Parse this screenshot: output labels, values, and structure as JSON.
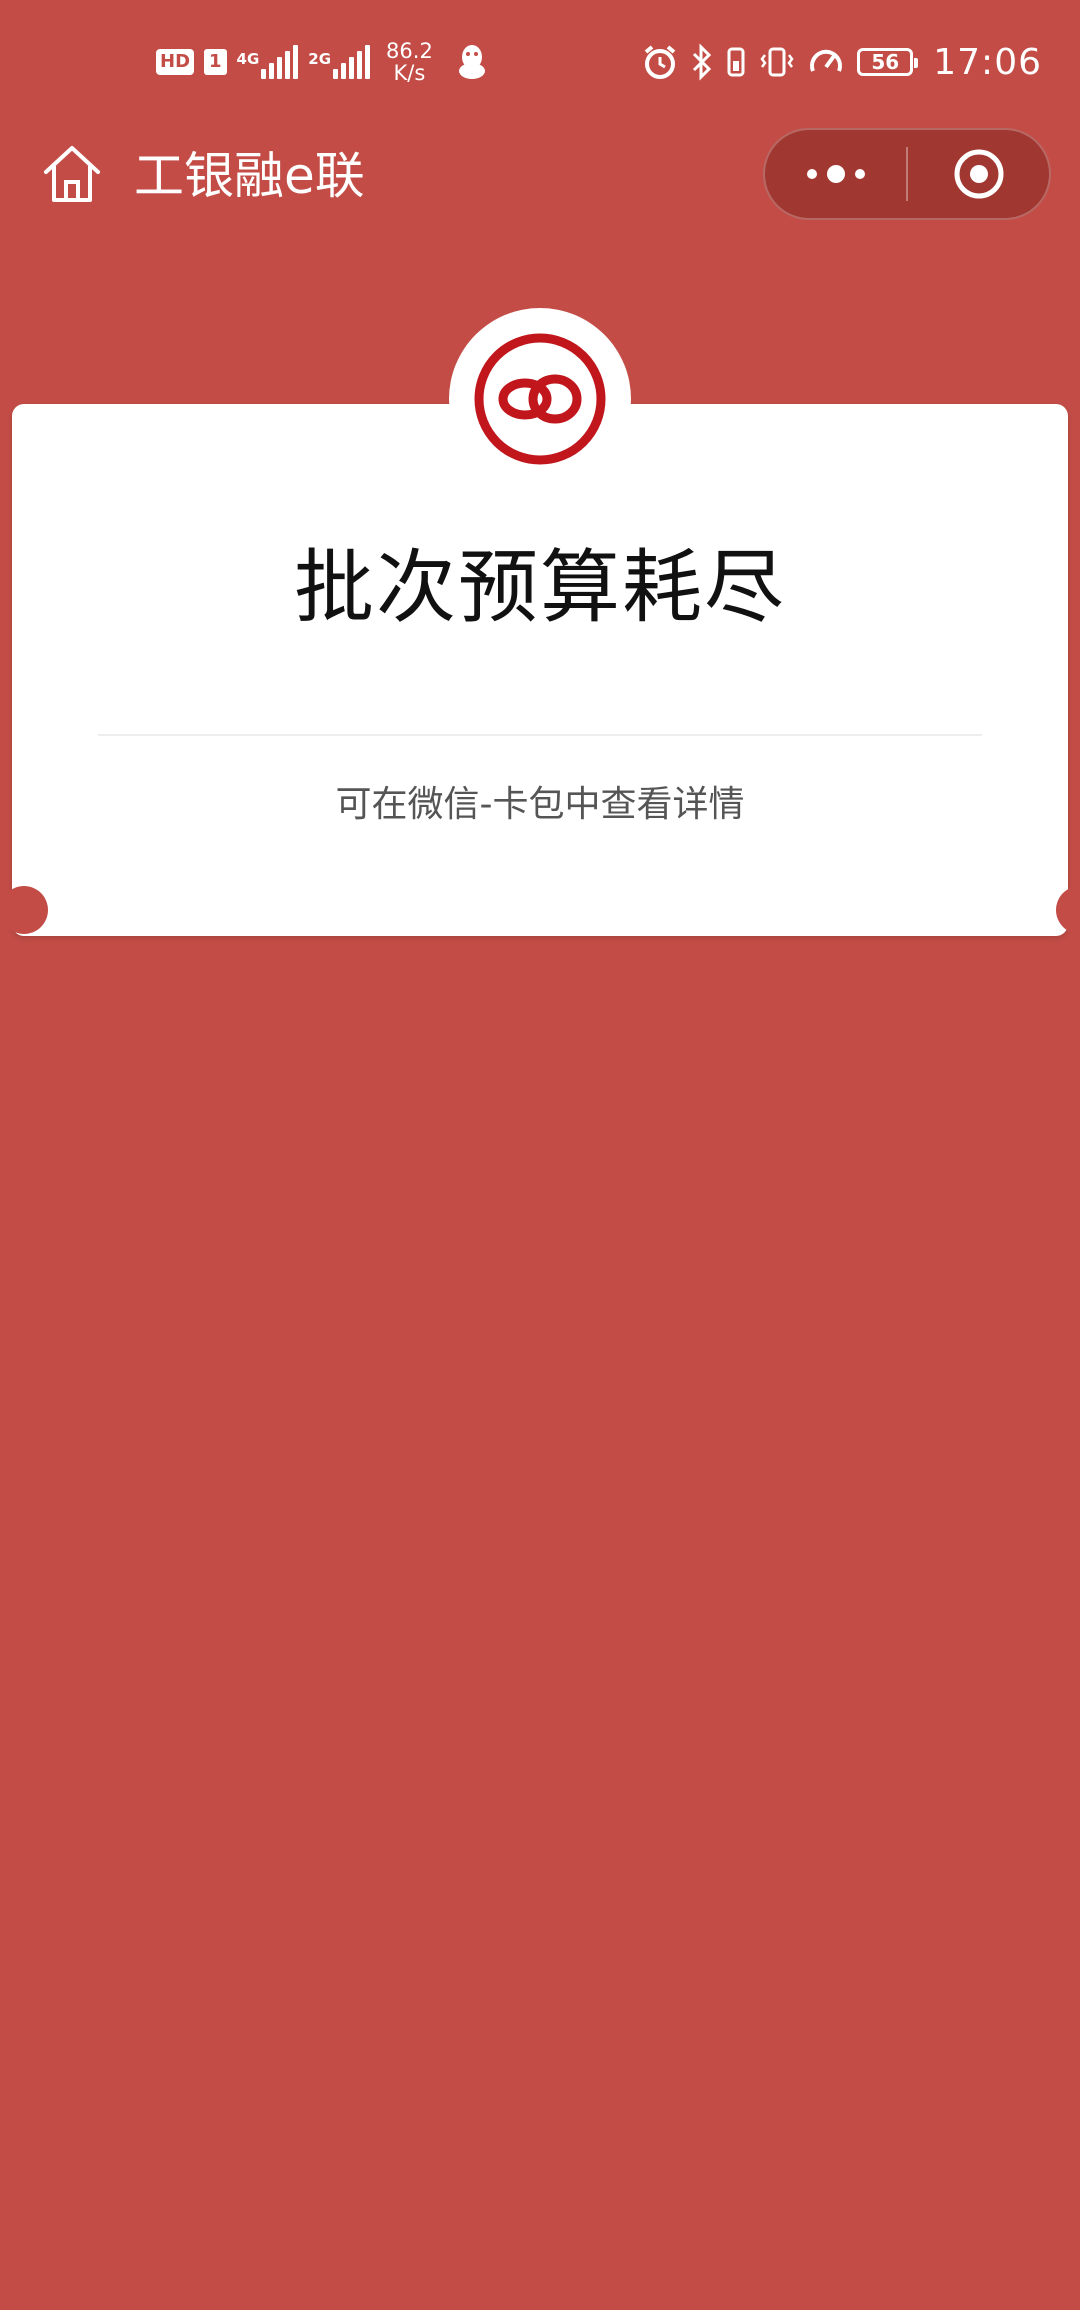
{
  "status_bar": {
    "hd_label": "HD",
    "sim_label": "1",
    "network_1": "4G",
    "network_2": "2G",
    "speed_value": "86.2",
    "speed_unit": "K/s",
    "battery_level": "56",
    "time": "17:06"
  },
  "nav": {
    "title": "工银融e联"
  },
  "card": {
    "title": "批次预算耗尽",
    "subtitle": "可在微信-卡包中查看详情"
  },
  "colors": {
    "background": "#c34d46",
    "logo_red": "#c0161c",
    "card": "#ffffff"
  }
}
